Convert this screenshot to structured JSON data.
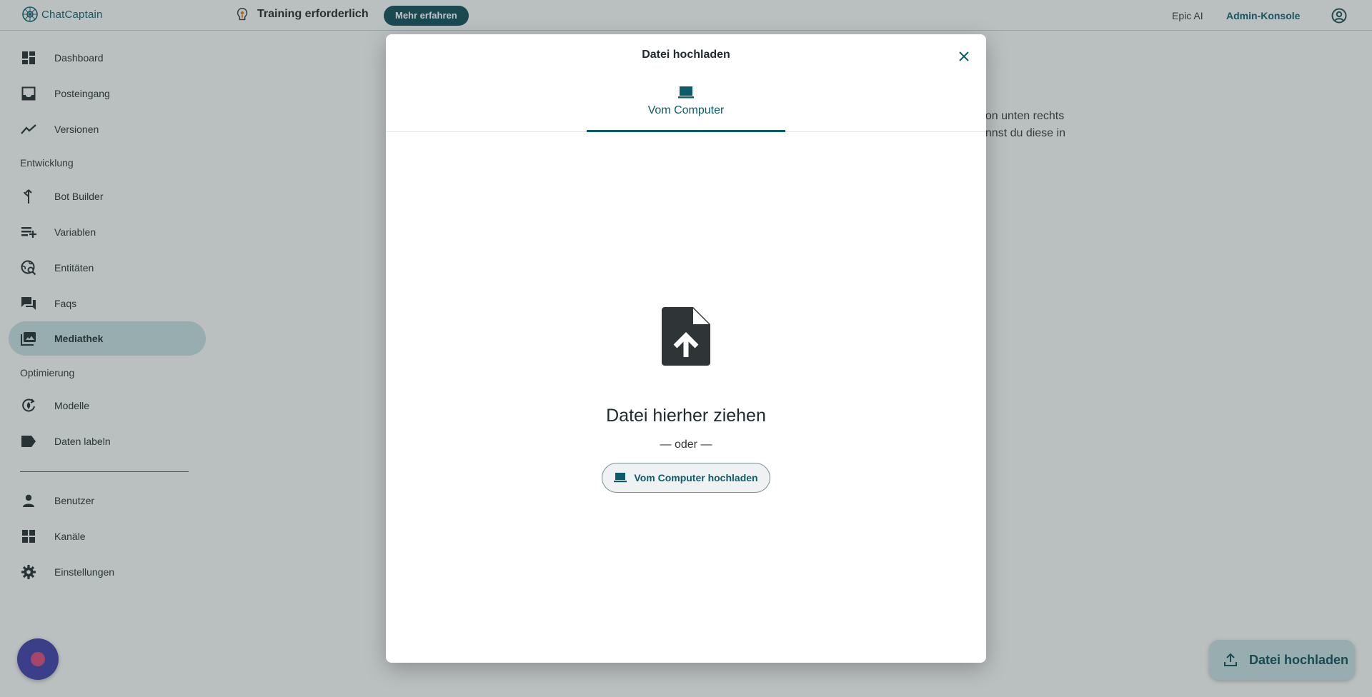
{
  "topbar": {
    "logo_text": "ChatCaptain",
    "training_text": "Training erforderlich",
    "mehr_button": "Mehr erfahren",
    "workspace": "Epic AI",
    "admin_link": "Admin-Konsole"
  },
  "sidebar": {
    "items_top": [
      {
        "label": "Dashboard",
        "icon": "dashboard-icon"
      },
      {
        "label": "Posteingang",
        "icon": "inbox-icon"
      },
      {
        "label": "Versionen",
        "icon": "trend-icon"
      }
    ],
    "section_dev": "Entwicklung",
    "items_dev": [
      {
        "label": "Bot Builder",
        "icon": "merge-icon"
      },
      {
        "label": "Variablen",
        "icon": "playlist-add-icon"
      },
      {
        "label": "Entitäten",
        "icon": "travel-explore-icon"
      },
      {
        "label": "Faqs",
        "icon": "forum-icon"
      },
      {
        "label": "Mediathek",
        "icon": "photo-library-icon",
        "active": true
      }
    ],
    "section_opt": "Optimierung",
    "items_opt": [
      {
        "label": "Modelle",
        "icon": "model-icon"
      },
      {
        "label": "Daten labeln",
        "icon": "label-icon"
      }
    ],
    "items_admin": [
      {
        "label": "Benutzer",
        "icon": "person-icon"
      },
      {
        "label": "Kanäle",
        "icon": "widgets-icon"
      },
      {
        "label": "Einstellungen",
        "icon": "gear-icon"
      }
    ]
  },
  "main": {
    "bg_line1": "tton unten rechts",
    "bg_line2": "annst du diese in",
    "fab_label": "Datei hochladen"
  },
  "modal": {
    "title": "Datei hochladen",
    "tab_label": "Vom Computer",
    "drop_title": "Datei hierher ziehen",
    "oder": "— oder —",
    "upload_button": "Vom Computer hochladen"
  },
  "colors": {
    "accent": "#0b5d6b",
    "accent_dark": "#0b4a58",
    "active_bg": "#c3dde0",
    "chat_bubble": "#3b3ba8"
  }
}
